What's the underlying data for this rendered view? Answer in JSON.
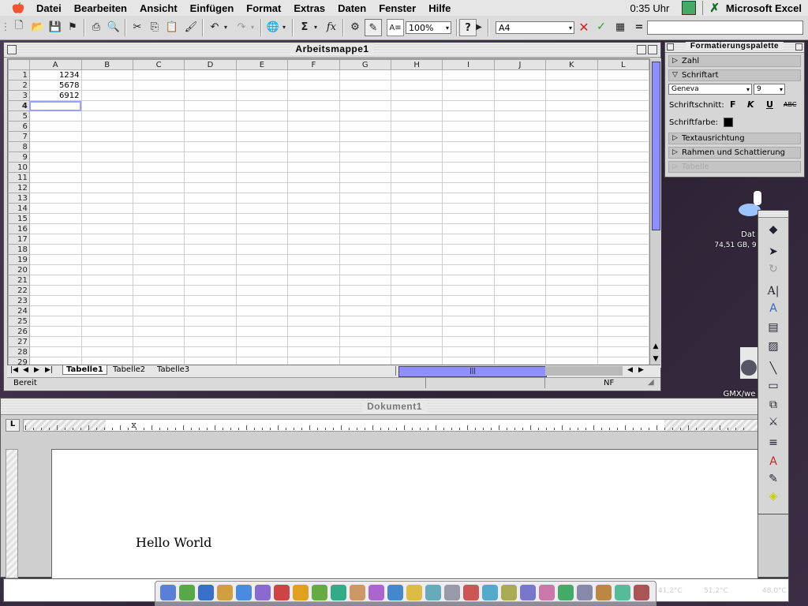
{
  "menubar": {
    "items": [
      "Datei",
      "Bearbeiten",
      "Ansicht",
      "Einfügen",
      "Format",
      "Extras",
      "Daten",
      "Fenster",
      "Hilfe"
    ],
    "clock": "0:35 Uhr",
    "app_name": "Microsoft Excel"
  },
  "toolbar": {
    "zoom": "100%",
    "name_box": "A4",
    "equals": "=",
    "formula": ""
  },
  "excel": {
    "title": "Arbeitsmappe1",
    "columns": [
      "A",
      "B",
      "C",
      "D",
      "E",
      "F",
      "G",
      "H",
      "I",
      "J",
      "K",
      "L"
    ],
    "row_count": 29,
    "cells": {
      "1": "1234",
      "2": "5678",
      "3": "6912"
    },
    "active_row": 4,
    "sheets": [
      "Tabelle1",
      "Tabelle2",
      "Tabelle3"
    ],
    "status": "Bereit",
    "indicator": "NF"
  },
  "palette": {
    "title": "Formatierungspalette",
    "sections": [
      "Zahl",
      "Schriftart",
      "Textausrichtung",
      "Rahmen und Schattierung",
      "Tabelle"
    ],
    "font_name": "Geneva",
    "font_size": "9",
    "style_label": "Schriftschnitt:",
    "style_buttons": [
      "F",
      "K",
      "U",
      "ABC"
    ],
    "color_label": "Schriftfarbe:"
  },
  "word": {
    "title": "Dokument1",
    "text": "Hello World",
    "tab_marker": "L"
  },
  "desktop": {
    "disk_label": "Dat",
    "disk_info": "74,51 GB, 9",
    "gmx_label": "GMX/we",
    "temps": [
      "41,2°C",
      "51,2°C",
      "48,0°C"
    ]
  },
  "colors": {
    "accent": "#8f8fff",
    "menubar": "#e6e6e6",
    "desktop": "#3d2f47"
  }
}
